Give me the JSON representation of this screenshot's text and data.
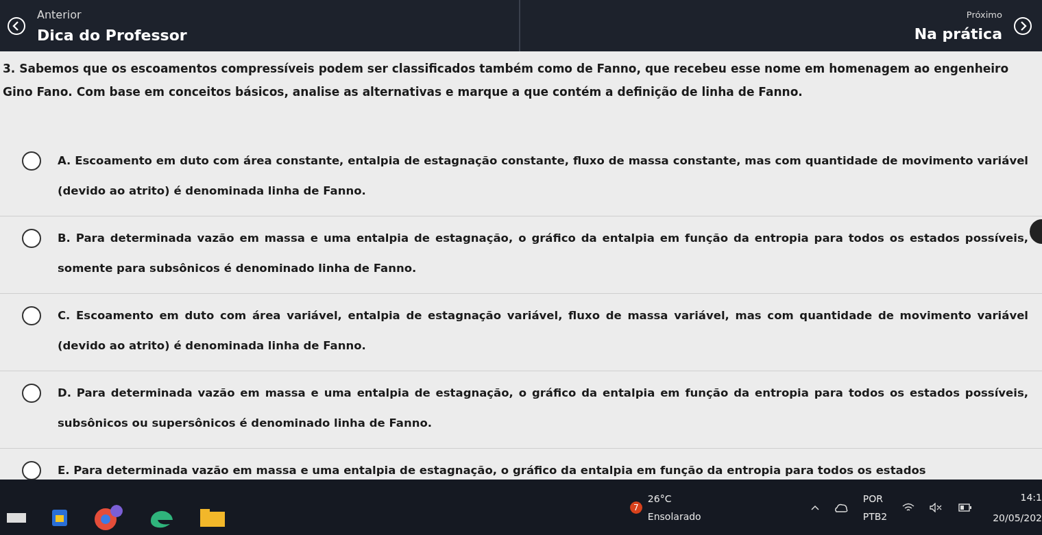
{
  "nav": {
    "previous": {
      "label": "Anterior",
      "title": "Dica do Professor"
    },
    "next": {
      "label": "Próximo",
      "title": "Na prática"
    }
  },
  "question": "3. Sabemos que os escoamentos compressíveis podem ser classificados também como de Fanno, que recebeu esse nome em homenagem ao engenheiro Gino Fano. Com base em conceitos básicos, analise as alternativas e marque a que contém a definição de linha de Fanno.",
  "options": [
    {
      "text": "A. Escoamento em duto com área constante, entalpia de estagnação constante, fluxo de massa constante, mas com quantidade de movimento variável (devido ao atrito) é denominada linha de Fanno.",
      "selected": false
    },
    {
      "text": "B. Para determinada vazão em massa e uma entalpia de estagnação, o gráfico da entalpia em função da entropia para todos os estados possíveis, somente para subsônicos é denominado linha de Fanno.",
      "selected": false
    },
    {
      "text": "C. Escoamento em duto com área variável, entalpia de estagnação variável, fluxo de massa variável, mas com quantidade de movimento variável (devido ao atrito) é denominada linha de Fanno.",
      "selected": false
    },
    {
      "text": "D. Para determinada vazão em massa e uma entalpia de estagnação, o gráfico da entalpia em função da entropia para todos os estados possíveis, subsônicos ou supersônicos é denominado linha de Fanno.",
      "selected": false
    },
    {
      "text": "E. Para determinada vazão em massa e uma entalpia de estagnação, o gráfico da entalpia em função da entropia para todos os estados",
      "selected": false
    }
  ],
  "taskbar": {
    "weather": {
      "badge": "7",
      "temperature": "26°C",
      "condition": "Ensolarado"
    },
    "language": {
      "primary": "POR",
      "secondary": "PTB2"
    },
    "clock": {
      "time": "14:1",
      "date": "20/05/202"
    }
  }
}
